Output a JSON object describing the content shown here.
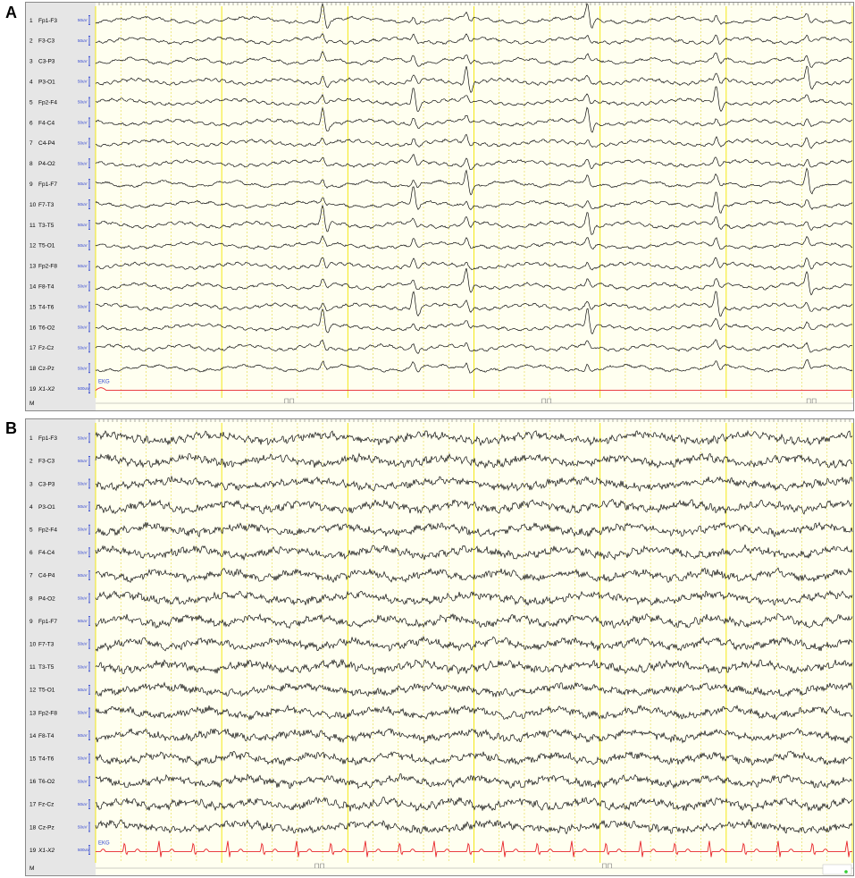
{
  "panels": [
    {
      "letter": "A",
      "channels": [
        {
          "num": "1",
          "name": "Fp1-F3",
          "scale": "50uV"
        },
        {
          "num": "2",
          "name": "F3-C3",
          "scale": "50uV"
        },
        {
          "num": "3",
          "name": "C3-P3",
          "scale": "50uV"
        },
        {
          "num": "4",
          "name": "P3-O1",
          "scale": "50uV"
        },
        {
          "num": "5",
          "name": "Fp2-F4",
          "scale": "50uV"
        },
        {
          "num": "6",
          "name": "F4-C4",
          "scale": "50uV"
        },
        {
          "num": "7",
          "name": "C4-P4",
          "scale": "50uV"
        },
        {
          "num": "8",
          "name": "P4-O2",
          "scale": "50uV"
        },
        {
          "num": "9",
          "name": "Fp1-F7",
          "scale": "50uV"
        },
        {
          "num": "10",
          "name": "F7-T3",
          "scale": "50uV"
        },
        {
          "num": "11",
          "name": "T3-T5",
          "scale": "50uV"
        },
        {
          "num": "12",
          "name": "T5-O1",
          "scale": "50uV"
        },
        {
          "num": "13",
          "name": "Fp2-F8",
          "scale": "50uV"
        },
        {
          "num": "14",
          "name": "F8-T4",
          "scale": "50uV"
        },
        {
          "num": "15",
          "name": "T4-T6",
          "scale": "50uV"
        },
        {
          "num": "16",
          "name": "T6-O2",
          "scale": "50uV"
        },
        {
          "num": "17",
          "name": "Fz-Cz",
          "scale": "50uV"
        },
        {
          "num": "18",
          "name": "Cz-Pz",
          "scale": "50uV"
        },
        {
          "num": "19",
          "name": "X1-X2",
          "scale": "500uV"
        }
      ],
      "marker_label": "M",
      "ekg_label": "EKG"
    },
    {
      "letter": "B",
      "channels": [
        {
          "num": "1",
          "name": "Fp1-F3",
          "scale": "50uV"
        },
        {
          "num": "2",
          "name": "F3-C3",
          "scale": "50uV"
        },
        {
          "num": "3",
          "name": "C3-P3",
          "scale": "50uV"
        },
        {
          "num": "4",
          "name": "P3-O1",
          "scale": "50uV"
        },
        {
          "num": "5",
          "name": "Fp2-F4",
          "scale": "50uV"
        },
        {
          "num": "6",
          "name": "F4-C4",
          "scale": "50uV"
        },
        {
          "num": "7",
          "name": "C4-P4",
          "scale": "50uV"
        },
        {
          "num": "8",
          "name": "P4-O2",
          "scale": "50uV"
        },
        {
          "num": "9",
          "name": "Fp1-F7",
          "scale": "50uV"
        },
        {
          "num": "10",
          "name": "F7-T3",
          "scale": "50uV"
        },
        {
          "num": "11",
          "name": "T3-T5",
          "scale": "50uV"
        },
        {
          "num": "12",
          "name": "T5-O1",
          "scale": "50uV"
        },
        {
          "num": "13",
          "name": "Fp2-F8",
          "scale": "50uV"
        },
        {
          "num": "14",
          "name": "F8-T4",
          "scale": "50uV"
        },
        {
          "num": "15",
          "name": "T4-T6",
          "scale": "50uV"
        },
        {
          "num": "16",
          "name": "T6-O2",
          "scale": "50uV"
        },
        {
          "num": "17",
          "name": "Fz-Cz",
          "scale": "50uV"
        },
        {
          "num": "18",
          "name": "Cz-Pz",
          "scale": "50uV"
        },
        {
          "num": "19",
          "name": "X1-X2",
          "scale": "500uV"
        }
      ],
      "marker_label": "M",
      "ekg_label": "EKG"
    }
  ],
  "colors": {
    "trace": "#111111",
    "ekg_trace": "#e8262b",
    "label_panel_bg": "#e6e6e6",
    "plot_bg": "#fffff0",
    "grid_major": "#f2e600",
    "grid_minor": "#d8d8d8",
    "scale_blue": "#2a3fd0",
    "marker_dot": "#33cc33"
  },
  "chart_data": [
    {
      "type": "line",
      "title": "A",
      "series_names_from_labels": true,
      "channel_count": 19,
      "ekg_channel": "X1-X2",
      "spike_times_fraction": [
        0.3,
        0.42,
        0.49,
        0.65,
        0.82,
        0.94
      ]
    },
    {
      "type": "line",
      "title": "B",
      "series_names_from_labels": true,
      "channel_count": 19,
      "ekg_channel": "X1-X2",
      "ekg_beats": 22
    }
  ]
}
